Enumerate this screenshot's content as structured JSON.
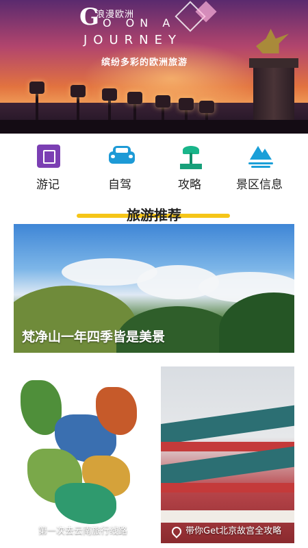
{
  "banner": {
    "brand_cn": "浪漫欧洲",
    "brand_g": "G",
    "line2": "O ON A",
    "line3": "JOURNEY",
    "subtitle": "缤纷多彩的欧洲旅游"
  },
  "nav": {
    "items": [
      {
        "label": "游记",
        "icon": "journal-icon",
        "color": "#7b3fb3"
      },
      {
        "label": "自驾",
        "icon": "car-icon",
        "color": "#1d9ad6"
      },
      {
        "label": "攻略",
        "icon": "palm-tree-icon",
        "color": "#19b58a"
      },
      {
        "label": "景区信息",
        "icon": "mountain-lake-icon",
        "color": "#1a9fd8"
      }
    ]
  },
  "section": {
    "title": "旅游推荐",
    "accent_color": "#f5c518"
  },
  "feature": {
    "label": "梵净山一年四季皆是美景"
  },
  "cards": [
    {
      "label": "第一次去云南旅行线路",
      "icon": "location-pin-icon"
    },
    {
      "label": "带你Get北京故宫全攻略",
      "icon": "location-pin-icon"
    }
  ]
}
